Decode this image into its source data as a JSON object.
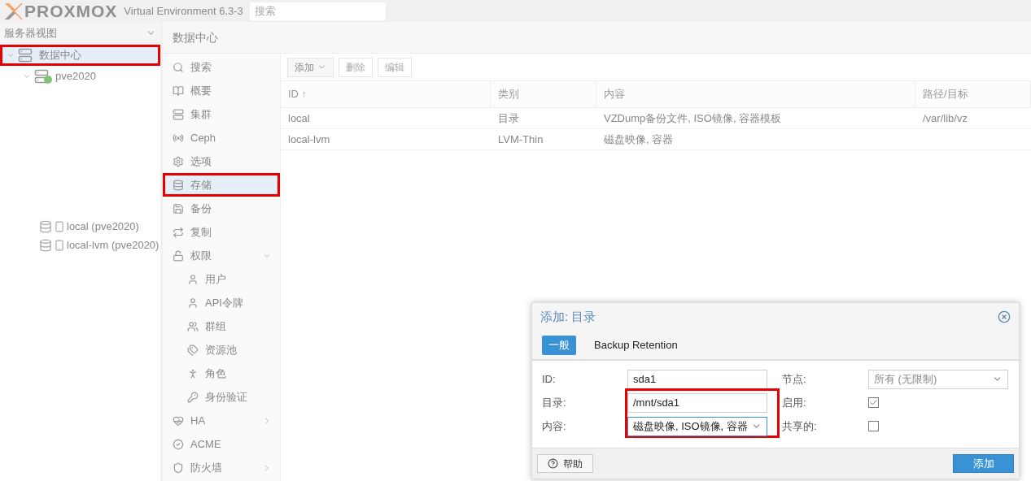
{
  "header": {
    "logo": "PROXMOX",
    "version": "Virtual Environment 6.3-3",
    "search": {
      "placeholder": "搜索"
    }
  },
  "tree": {
    "view_selector": "服务器视图",
    "nodes": [
      {
        "label": "数据中心",
        "kind": "datacenter",
        "selected": true,
        "annotated": true,
        "expanded": true,
        "children": [
          {
            "label": "pve2020",
            "kind": "node",
            "selected": false,
            "annotated": false,
            "expanded": true
          }
        ]
      }
    ],
    "storage_items": [
      {
        "label": "local (pve2020)"
      },
      {
        "label": "local-lvm (pve2020)"
      }
    ]
  },
  "content": {
    "title": "数据中心",
    "nav": [
      {
        "label": "搜索",
        "selected": false,
        "annotated": false
      },
      {
        "label": "概要",
        "selected": false,
        "annotated": false
      },
      {
        "label": "集群",
        "selected": false,
        "annotated": false
      },
      {
        "label": "Ceph",
        "selected": false,
        "annotated": false
      },
      {
        "label": "选项",
        "selected": false,
        "annotated": false
      },
      {
        "label": "存储",
        "selected": true,
        "annotated": true
      },
      {
        "label": "备份",
        "selected": false,
        "annotated": false
      },
      {
        "label": "复制",
        "selected": false,
        "annotated": false
      },
      {
        "label": "权限",
        "selected": false,
        "annotated": false,
        "expanded": true,
        "children": [
          {
            "label": "用户"
          },
          {
            "label": "API令牌"
          },
          {
            "label": "群组"
          },
          {
            "label": "资源池"
          },
          {
            "label": "角色"
          },
          {
            "label": "身份验证"
          }
        ]
      },
      {
        "label": "HA",
        "selected": false,
        "annotated": false,
        "expanded": false
      },
      {
        "label": "ACME",
        "selected": false,
        "annotated": false
      },
      {
        "label": "防火墙",
        "selected": false,
        "annotated": false,
        "expanded": false
      }
    ],
    "toolbar": [
      {
        "label": "添加",
        "dropdown": true,
        "disabled": false
      },
      {
        "label": "删除",
        "dropdown": false,
        "disabled": true
      },
      {
        "label": "编辑",
        "dropdown": false,
        "disabled": true
      }
    ],
    "table": {
      "columns": [
        "ID ↑",
        "类别",
        "内容",
        "路径/目标"
      ],
      "rows": [
        [
          "local",
          "目录",
          "VZDump备份文件, ISO镜像, 容器模板",
          "/var/lib/vz"
        ],
        [
          "local-lvm",
          "LVM-Thin",
          "磁盘映像, 容器",
          ""
        ]
      ]
    }
  },
  "dialog": {
    "title": "添加: 目录",
    "tabs": [
      {
        "label": "一般",
        "selected": true
      },
      {
        "label": "Backup Retention",
        "selected": false
      }
    ],
    "left_fields": [
      {
        "label": "ID:",
        "kind": "text",
        "value": "sda1",
        "annotated": false
      },
      {
        "label": "目录:",
        "kind": "text",
        "value": "/mnt/sda1",
        "annotated": true
      },
      {
        "label": "内容:",
        "kind": "select",
        "value": "磁盘映像, ISO镜像, 容器",
        "annotated": true
      }
    ],
    "right_fields": [
      {
        "label": "节点:",
        "kind": "select",
        "placeholder": "所有 (无限制)"
      },
      {
        "label": "启用:",
        "kind": "checkbox",
        "checked": true
      },
      {
        "label": "共享的:",
        "kind": "checkbox",
        "checked": false
      }
    ],
    "help_button": "帮助",
    "submit_button": "添加"
  }
}
